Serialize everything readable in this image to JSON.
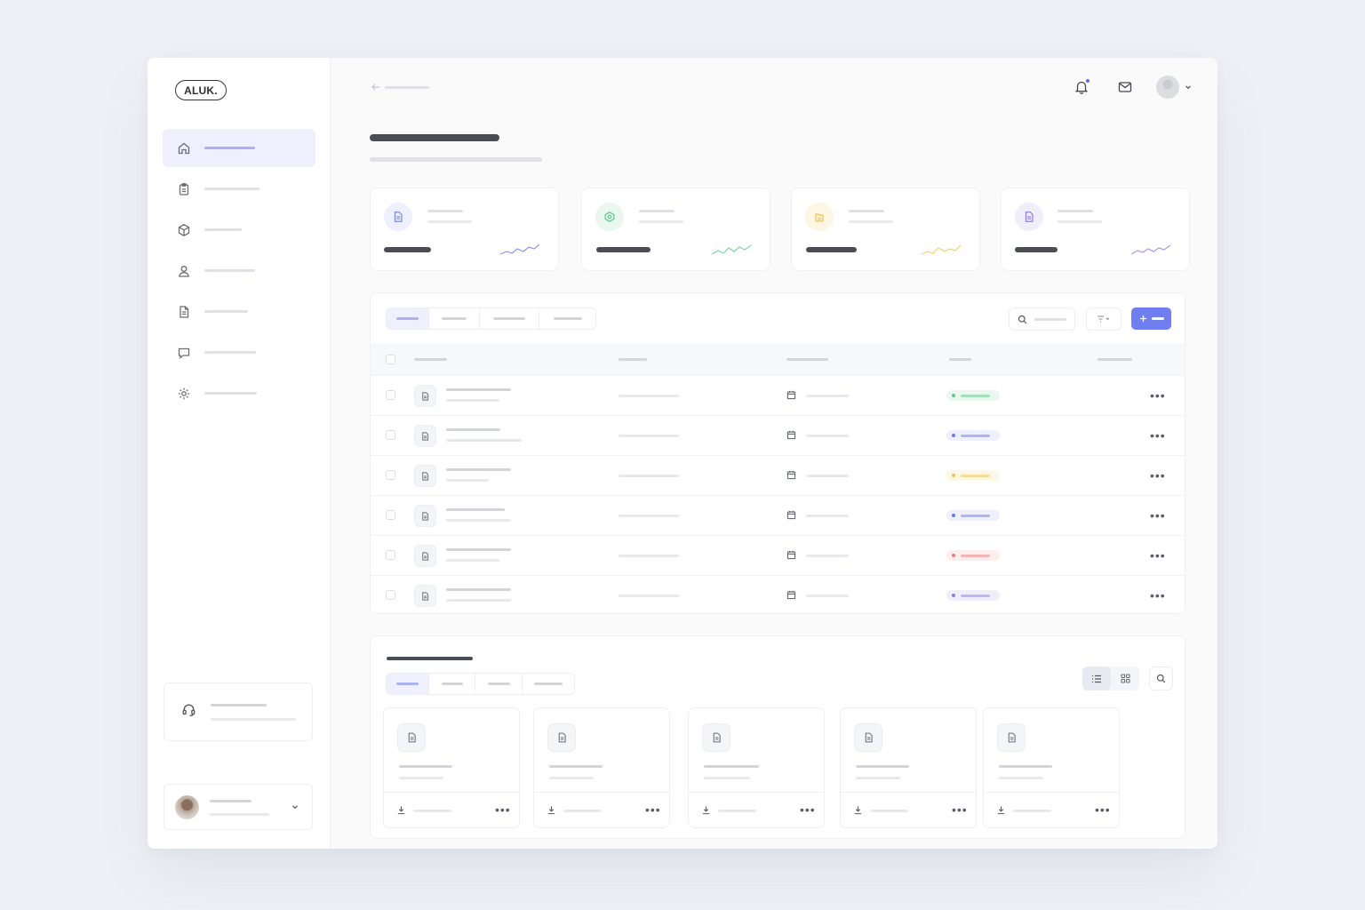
{
  "app": {
    "logo_text": "ALUK."
  },
  "colors": {
    "accent": "#6f7ef0",
    "accent_light": "#eef0fd",
    "status_green": "#5cc98a",
    "status_blue": "#6b7be8",
    "status_yellow": "#f0c44e",
    "status_red": "#ef7a7a",
    "status_purple": "#8b7fe6"
  },
  "sidebar": {
    "items": [
      {
        "icon": "home-icon",
        "active": true
      },
      {
        "icon": "clipboard-icon",
        "active": false
      },
      {
        "icon": "box-icon",
        "active": false
      },
      {
        "icon": "user-icon",
        "active": false
      },
      {
        "icon": "document-icon",
        "active": false
      },
      {
        "icon": "chat-icon",
        "active": false
      },
      {
        "icon": "gear-icon",
        "active": false
      }
    ],
    "support_icon": "headset-icon"
  },
  "header": {
    "icons": [
      "bell-icon",
      "mail-icon",
      "avatar",
      "chevron-down-icon"
    ],
    "notification_dot": true
  },
  "stats": [
    {
      "icon": "document-icon",
      "color": "#7a86e8",
      "bg": "#eef0fd"
    },
    {
      "icon": "chart-icon",
      "color": "#5cc98a",
      "bg": "#e9f7ef"
    },
    {
      "icon": "folder-icon",
      "color": "#f0c44e",
      "bg": "#fdf6e3"
    },
    {
      "icon": "document-icon",
      "color": "#8b7fe6",
      "bg": "#f1eefc"
    }
  ],
  "table": {
    "rows": [
      {
        "status_color": "#5cc98a",
        "status_bg": "#eaf7ef"
      },
      {
        "status_color": "#6b7be8",
        "status_bg": "#eef0fd"
      },
      {
        "status_color": "#f0c44e",
        "status_bg": "#fdf7e6"
      },
      {
        "status_color": "#6b7be8",
        "status_bg": "#eef0fd"
      },
      {
        "status_color": "#ef7a7a",
        "status_bg": "#fdeeee"
      },
      {
        "status_color": "#8b7fe6",
        "status_bg": "#f1eefc"
      }
    ],
    "add_button_icon": "plus-icon"
  },
  "files": {
    "cards": 5,
    "view_mode": "list"
  }
}
